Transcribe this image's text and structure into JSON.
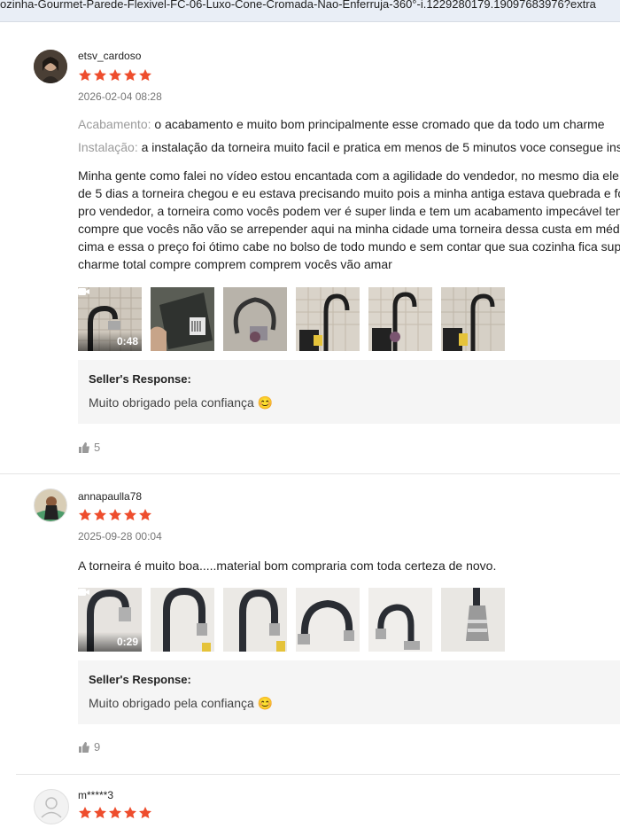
{
  "url_text": "ozinha-Gourmet-Parede-Flexivel-FC-06-Luxo-Cone-Cromada-Nao-Enferruja-360°-i.1229280179.19097683976?extra",
  "colors": {
    "star": "#ee4d2d",
    "seller_bg": "#f5f5f5"
  },
  "reviews": [
    {
      "username": "etsv_cardoso",
      "rating": 5,
      "date": "2026-02-04 08:28",
      "attrs": [
        {
          "key": "Acabamento:",
          "value": "o acabamento e muito bom principalmente esse cromado que da todo um charme"
        },
        {
          "key": "Instalação:",
          "value": "a instalação da torneira muito facil e pratica em menos de 5 minutos voce consegue ins"
        }
      ],
      "text_lines": [
        "Minha gente como falei no vídeo estou encantada com a agilidade do vendedor, no mesmo dia ele",
        "de 5 dias a torneira chegou e eu estava precisando muito pois a minha antiga estava quebrada e fo",
        "pro vendedor, a torneira como vocês podem ver é super linda e tem um acabamento impecável tem",
        "compre que vocês não vão se arrepender aqui na minha cidade uma torneira dessa custa em média",
        "cima e essa o preço foi ótimo cabe no bolso de todo mundo e sem contar que sua cozinha fica sup",
        "charme total compre comprem comprem vocês vão amar"
      ],
      "video_duration": "0:48",
      "seller_title": "Seller's Response:",
      "seller_message": "Muito obrigado pela confiança 😊",
      "likes": "5"
    },
    {
      "username": "annapaulla78",
      "rating": 5,
      "date": "2025-09-28 00:04",
      "text_lines": [
        "A torneira é muito boa.....material bom compraria com toda certeza de novo."
      ],
      "video_duration": "0:29",
      "seller_title": "Seller's Response:",
      "seller_message": "Muito obrigado pela confiança 😊",
      "likes": "9"
    },
    {
      "username": "m*****3",
      "rating": 5
    }
  ]
}
